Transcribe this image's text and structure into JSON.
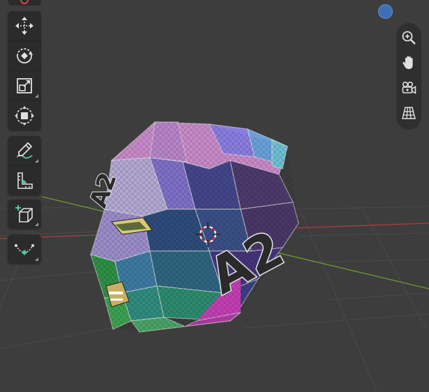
{
  "viewport": {
    "texture_label": "A2",
    "texture_label_side": "A2"
  },
  "toolbar": {
    "items": [
      {
        "name": "move-tool",
        "icon": "move-icon",
        "has_submenu": false
      },
      {
        "name": "rotate-tool",
        "icon": "rotate-icon",
        "has_submenu": false
      },
      {
        "name": "scale-tool",
        "icon": "scale-icon",
        "has_submenu": true
      },
      {
        "name": "transform-tool",
        "icon": "transform-icon",
        "has_submenu": false
      },
      {
        "name": "annotate-tool",
        "icon": "annotate-pencil-icon",
        "has_submenu": true
      },
      {
        "name": "measure-tool",
        "icon": "measure-ruler-icon",
        "has_submenu": false
      },
      {
        "name": "add-cube-tool",
        "icon": "add-cube-icon",
        "has_submenu": true
      },
      {
        "name": "extrude-tool",
        "icon": "curve-vertex-icon",
        "has_submenu": true
      }
    ]
  },
  "navigation": {
    "items": [
      {
        "name": "zoom-button",
        "icon": "zoom-in-magnifier-icon"
      },
      {
        "name": "pan-button",
        "icon": "hand-pan-icon"
      },
      {
        "name": "camera-view-button",
        "icon": "camera-icon"
      },
      {
        "name": "perspective-toggle-button",
        "icon": "grid-perspective-icon"
      }
    ]
  },
  "colors": {
    "background": "#3d3d3d",
    "panel": "#2b2b2b",
    "x_axis": "#b03a3a",
    "y_axis": "#6e9a2e",
    "gizmo_ball": "#3e6fb8",
    "magenta_face": "#c23fb2"
  }
}
